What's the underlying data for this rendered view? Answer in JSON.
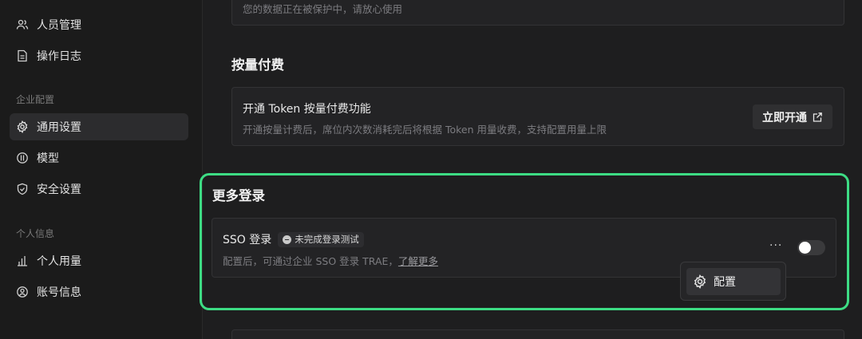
{
  "sidebar": {
    "items_top": [
      {
        "label": "人员管理",
        "icon": "users-icon"
      },
      {
        "label": "操作日志",
        "icon": "document-icon"
      }
    ],
    "section_enterprise": "企业配置",
    "items_enterprise": [
      {
        "label": "通用设置",
        "icon": "gear-icon",
        "active": true
      },
      {
        "label": "模型",
        "icon": "model-icon"
      },
      {
        "label": "安全设置",
        "icon": "shield-icon"
      }
    ],
    "section_personal": "个人信息",
    "items_personal": [
      {
        "label": "个人用量",
        "icon": "bar-chart-icon"
      },
      {
        "label": "账号信息",
        "icon": "user-circle-icon"
      }
    ]
  },
  "main": {
    "top_card_text": "您的数据正在被保护中，请放心使用",
    "pay_section": {
      "title": "按量付费",
      "card_title": "开通 Token 按量付费功能",
      "card_desc": "开通按量计费后，席位内次数消耗完后将根据 Token 用量收费，支持配置用量上限",
      "button_label": "立即开通"
    },
    "login_section": {
      "title": "更多登录",
      "sso_title": "SSO 登录",
      "badge": "未完成登录测试",
      "desc": "配置后，可通过企业 SSO 登录 TRAE，",
      "link": "了解更多",
      "toggle_on": false,
      "more": "···"
    },
    "popover": {
      "item_label": "配置"
    }
  },
  "colors": {
    "highlight": "#3ddc84",
    "background": "#1e1e1f",
    "sidebar_bg": "#1b1b1b"
  }
}
